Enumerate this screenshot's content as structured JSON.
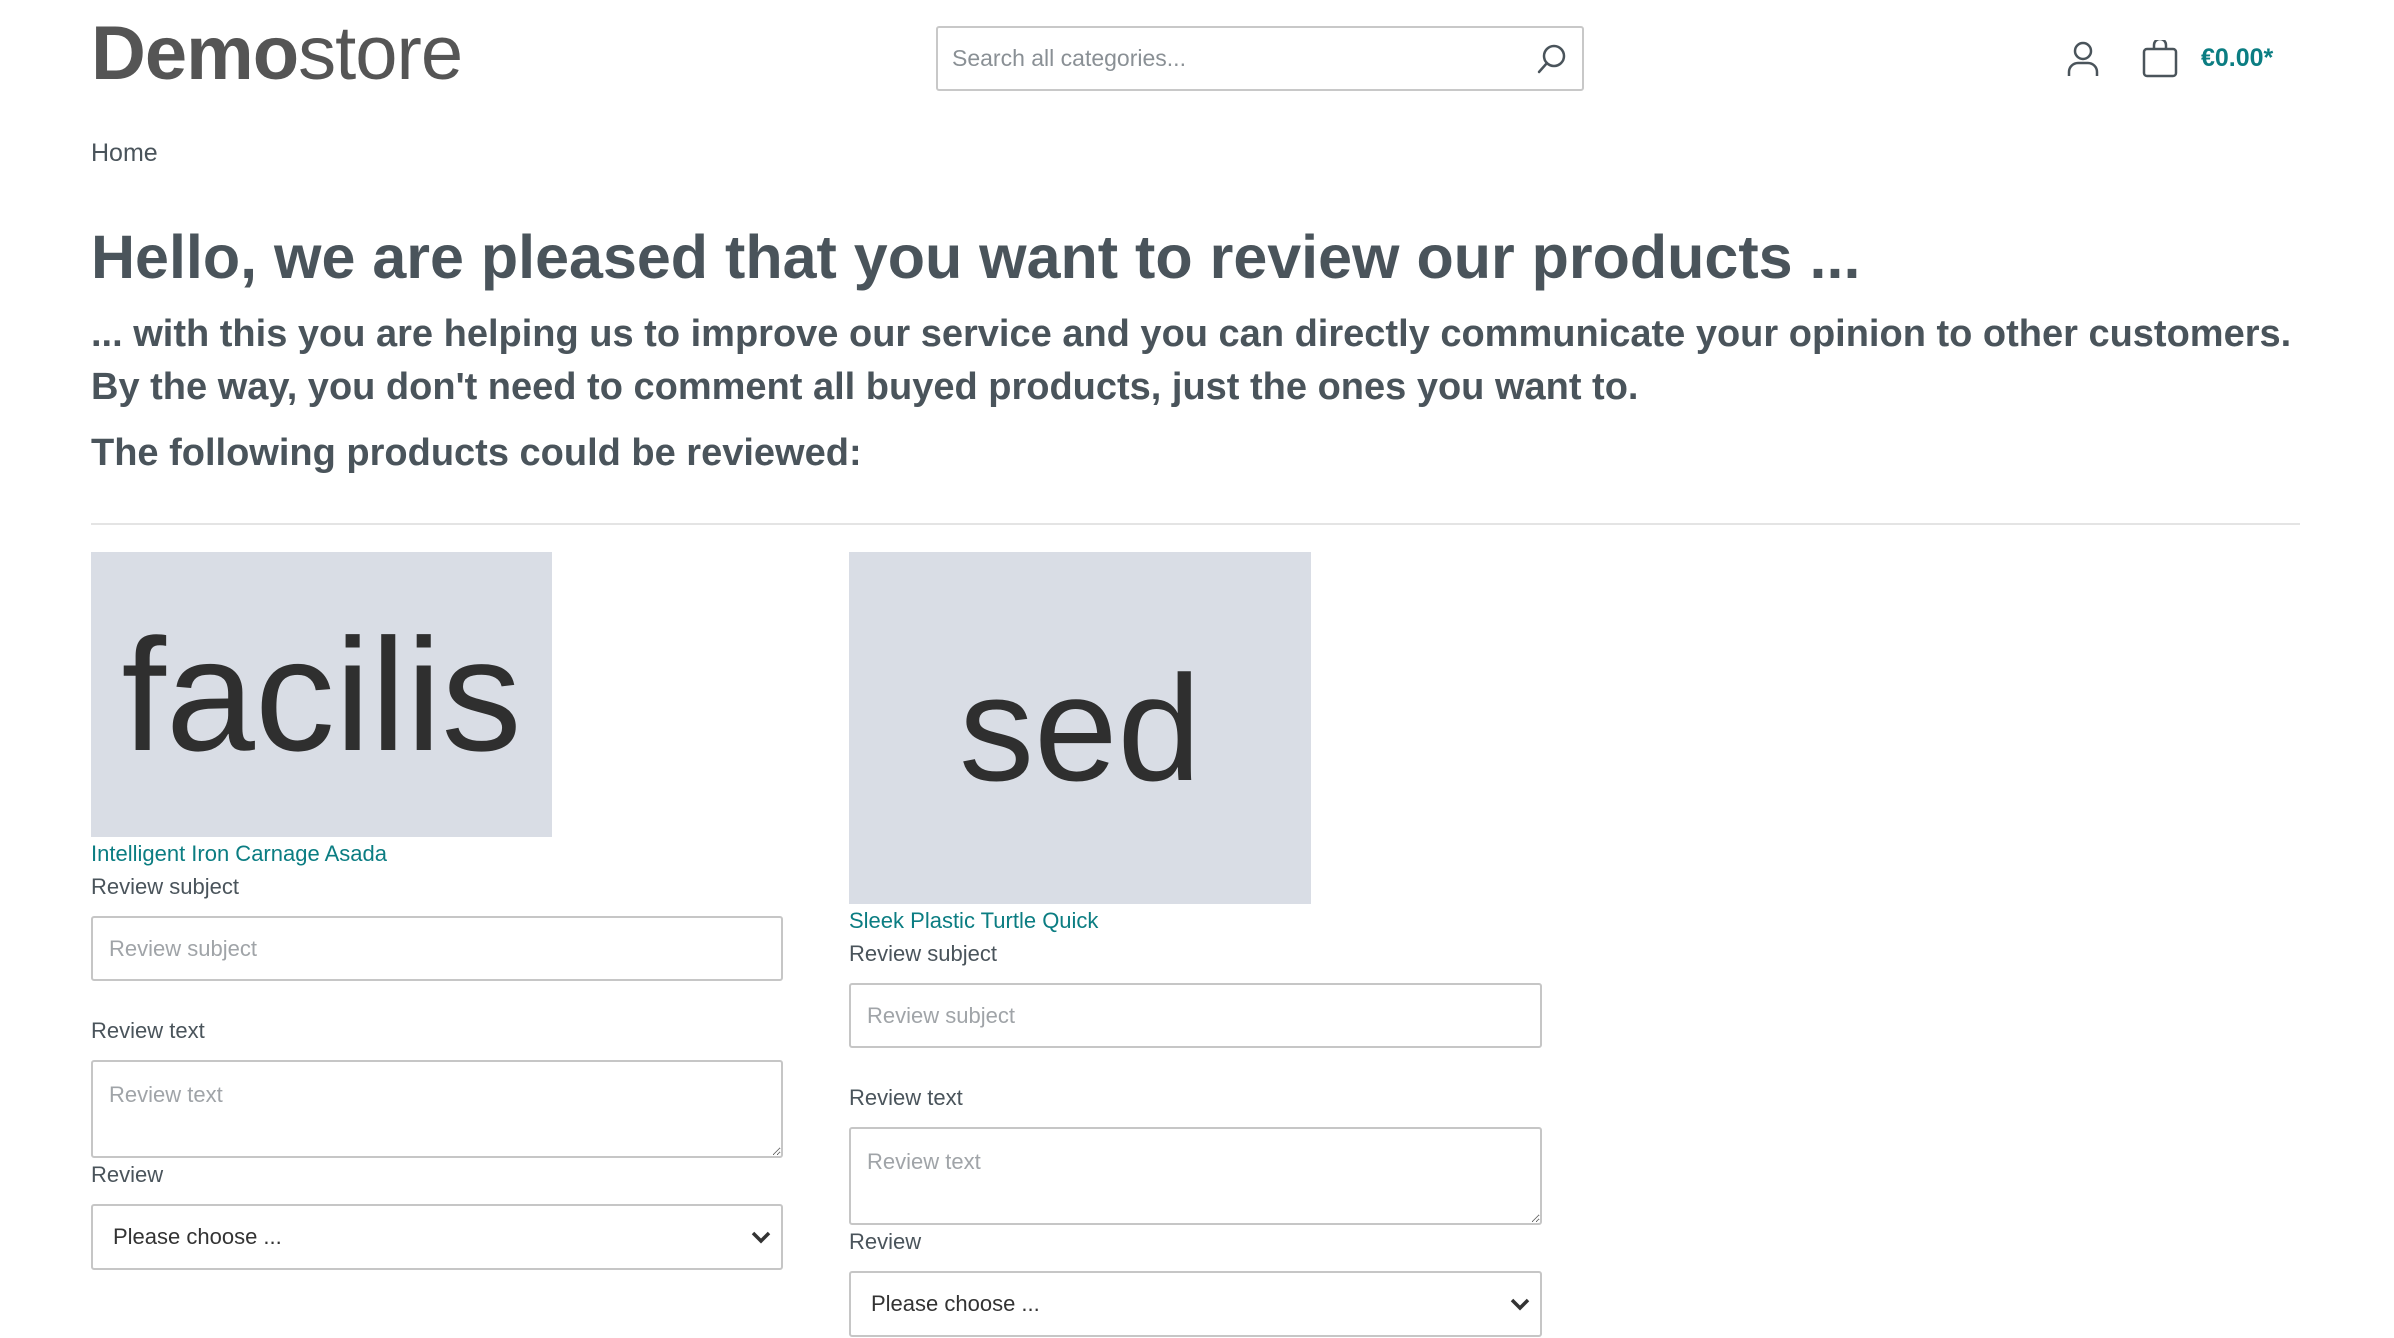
{
  "header": {
    "logo_bold": "Demo",
    "logo_light": "store",
    "search_placeholder": "Search all categories...",
    "cart_total": "€0.00*",
    "icons": [
      "search-icon",
      "user-icon",
      "cart-icon"
    ],
    "accent": "#0b7d82"
  },
  "breadcrumb": {
    "home": "Home"
  },
  "main": {
    "title": "Hello, we are pleased that you want to review our products ...",
    "subtitle": "... with this you are helping us to improve our service and you can directly communicate your opinion to other customers. By the way, you don't need to comment all buyed products, just the ones you want to.",
    "list_heading": "The following products could be reviewed:"
  },
  "products": [
    {
      "image_text": "facilis",
      "name": "Intelligent Iron Carnage Asada",
      "subject_label": "Review subject",
      "subject_placeholder": "Review subject",
      "text_label": "Review text",
      "text_placeholder": "Review text",
      "review_label": "Review",
      "review_value": "Please choose ..."
    },
    {
      "image_text": "sed",
      "name": "Sleek Plastic Turtle Quick",
      "subject_label": "Review subject",
      "subject_placeholder": "Review subject",
      "text_label": "Review text",
      "text_placeholder": "Review text",
      "review_label": "Review",
      "review_value": "Please choose ..."
    }
  ]
}
